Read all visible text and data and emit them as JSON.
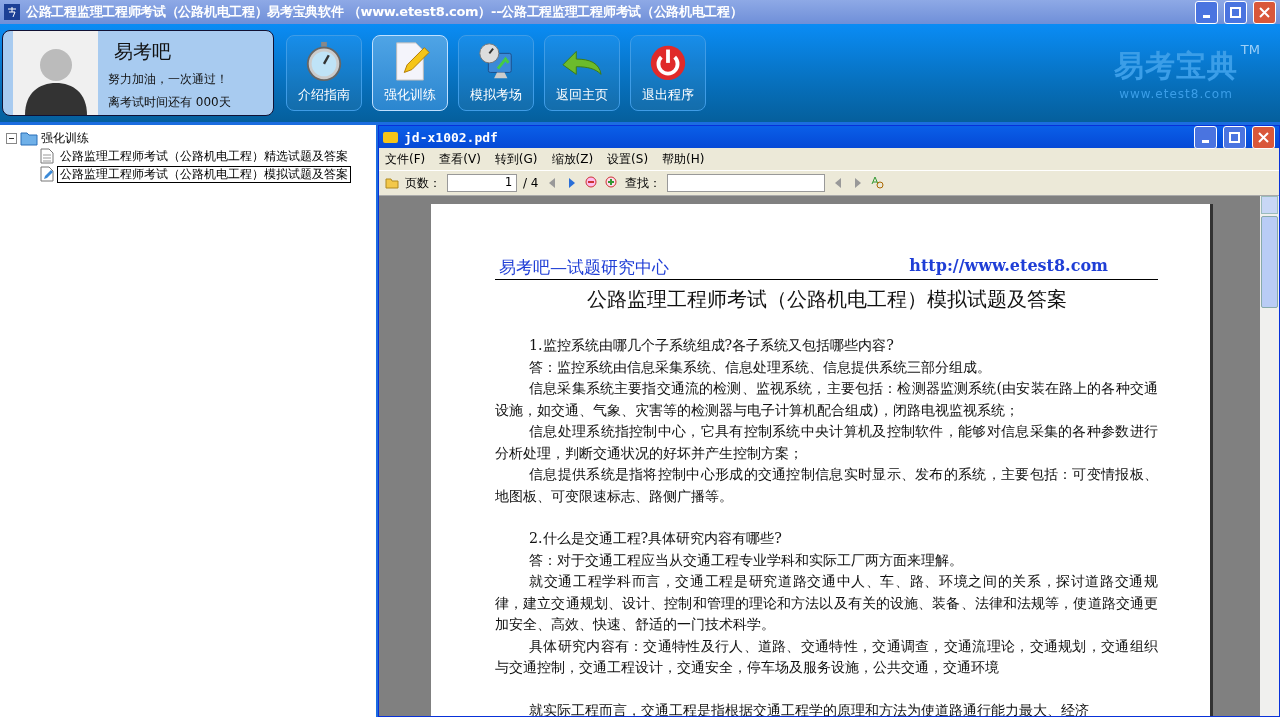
{
  "window": {
    "title": "公路工程监理工程师考试（公路机电工程）易考宝典软件 （www.etest8.com）--公路工程监理工程师考试（公路机电工程）"
  },
  "header": {
    "profile": {
      "name": "易考吧",
      "motto": "努力加油，一次通过！",
      "countdown": "离考试时间还有 000天"
    },
    "nav_buttons": [
      {
        "kind": "stopwatch",
        "label": "介绍指南",
        "selected": false
      },
      {
        "kind": "pencil",
        "label": "强化训练",
        "selected": true
      },
      {
        "kind": "monitor",
        "label": "模拟考场",
        "selected": false
      },
      {
        "kind": "back",
        "label": "返回主页",
        "selected": false
      },
      {
        "kind": "power",
        "label": "退出程序",
        "selected": false
      }
    ],
    "logo": {
      "text": "易考宝典",
      "mark": "TM",
      "url": "www.etest8.com"
    }
  },
  "tree": {
    "label": "强化训练",
    "expanded": true,
    "children": [
      {
        "label": "公路监理工程师考试（公路机电工程）精选试题及答案",
        "selected": false
      },
      {
        "label": "公路监理工程师考试（公路机电工程）模拟试题及答案",
        "selected": true
      }
    ]
  },
  "viewer": {
    "title": "jd-x1002.pdf",
    "menu": [
      "文件(F)",
      "查看(V)",
      "转到(G)",
      "缩放(Z)",
      "设置(S)",
      "帮助(H)"
    ],
    "toolbar": {
      "page_label": "页数：",
      "page_value": "1",
      "page_total": "/ 4",
      "find_label": "查找："
    },
    "document": {
      "header_left": "易考吧—试题研究中心",
      "header_right": "http://www.etest8.com",
      "title": "公路监理工程师考试（公路机电工程）模拟试题及答案",
      "paragraphs": [
        {
          "kind": "text",
          "text": "1.监控系统由哪几个子系统组成?各子系统又包括哪些内容?"
        },
        {
          "kind": "text",
          "text": "答：监控系统由信息采集系统、信息处理系统、信息提供系统三部分组成。"
        },
        {
          "kind": "text",
          "text": "信息采集系统主要指交通流的检测、监视系统，主要包括：检测器监测系统(由安装在路上的各种交通设施，如交通、气象、灾害等的检测器与电子计算机配合组成)，闭路电视监视系统；"
        },
        {
          "kind": "text",
          "text": "信息处理系统指控制中心，它具有控制系统中央计算机及控制软件，能够对信息采集的各种参数进行分析处理，判断交通状况的好坏并产生控制方案；"
        },
        {
          "kind": "text",
          "text": "信息提供系统是指将控制中心形成的交通控制信息实时显示、发布的系统，主要包括：可变情报板、地图板、可变限速标志、路侧广播等。"
        },
        {
          "kind": "gap",
          "text": "2.什么是交通工程?具体研究内容有哪些?"
        },
        {
          "kind": "text",
          "text": "答：对于交通工程应当从交通工程专业学科和实际工厂两方面来理解。"
        },
        {
          "kind": "text",
          "text": "就交通工程学科而言，交通工程是研究道路交通中人、车、路、环境之间的关系，探讨道路交通规律，建立交通规划、设计、控制和管理的理论和方法以及有关的设施、装备、法律和法规等，使道路交通更加安全、高效、快速、舒适的一门技术科学。"
        },
        {
          "kind": "text",
          "text": "具体研究内容有：交通特性及行人、道路、交通特性，交通调查，交通流理论，交通规划，交通组织与交通控制，交通工程设计，交通安全，停车场及服务设施，公共交通，交通环境"
        },
        {
          "kind": "gap",
          "text": "就实际工程而言，交通工程是指根据交通工程学的原理和方法为使道路通行能力最大、经济"
        }
      ]
    }
  }
}
